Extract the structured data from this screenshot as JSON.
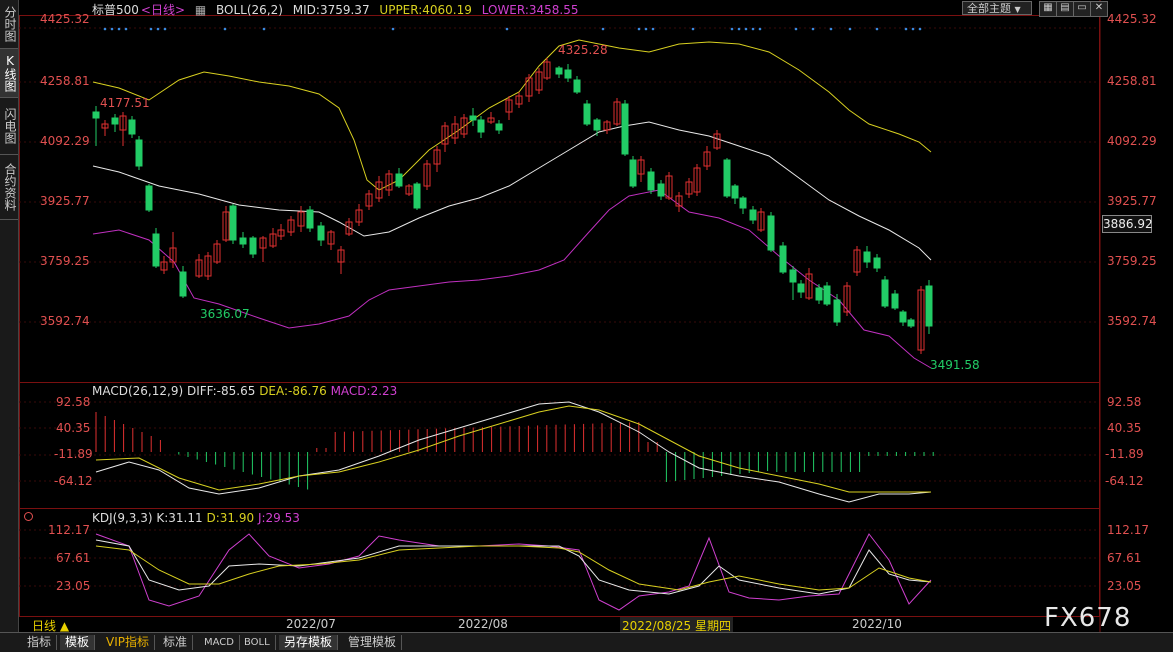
{
  "sidebar": {
    "tabs": [
      {
        "label": "分时图",
        "active": false
      },
      {
        "label": "K线图",
        "active": true
      },
      {
        "label": "闪电图",
        "active": false
      },
      {
        "label": "合约资料",
        "active": false
      }
    ]
  },
  "header": {
    "symbol": "标普500",
    "period_link": "<日线>",
    "boll_label": "BOLL(26,2)",
    "mid": "MID:3759.37",
    "upper": "UPPER:4060.19",
    "lower": "LOWER:3458.55",
    "theme_select": "全部主题",
    "theme_arrow": "▼"
  },
  "price_axis": {
    "ticks": [
      "4425.32",
      "4258.81",
      "4092.29",
      "3925.77",
      "3759.25",
      "3592.74"
    ],
    "current_price": "3886.92"
  },
  "annotations": {
    "high1": "4177.51",
    "low1": "3636.07",
    "high2": "4325.28",
    "low2": "3491.58"
  },
  "macd": {
    "title": "MACD(26,12,9)",
    "diff": "DIFF:-85.65",
    "dea": "DEA:-86.76",
    "macd": "MACD:2.23",
    "ticks": [
      "92.58",
      "40.35",
      "-11.89",
      "-64.12"
    ]
  },
  "kdj": {
    "title": "KDJ(9,3,3)",
    "k": "K:31.11",
    "d": "D:31.90",
    "j": "J:29.53",
    "ticks": [
      "112.17",
      "67.61",
      "23.05"
    ]
  },
  "x_axis": {
    "period": "日线 ▲",
    "labels": [
      "2022/07",
      "2022/08",
      "2022/08/25 星期四",
      "2022/10"
    ]
  },
  "bottom_tabs": [
    {
      "label": "指标",
      "active": false
    },
    {
      "label": "模板",
      "active": true
    },
    {
      "label": "VIP指标",
      "active": false
    },
    {
      "label": "标准",
      "active": false
    },
    {
      "label": "MACD",
      "active": false
    },
    {
      "label": "BOLL",
      "active": false
    },
    {
      "label": "另存模板",
      "active": true
    },
    {
      "label": "管理模板",
      "active": false
    }
  ],
  "watermark": "FX678",
  "colors": {
    "up": "#e03030",
    "down": "#22cc66",
    "upper": "#d8d020",
    "mid": "#e8e8e8",
    "lower": "#c030c0",
    "axis_text": "#e05050"
  }
}
